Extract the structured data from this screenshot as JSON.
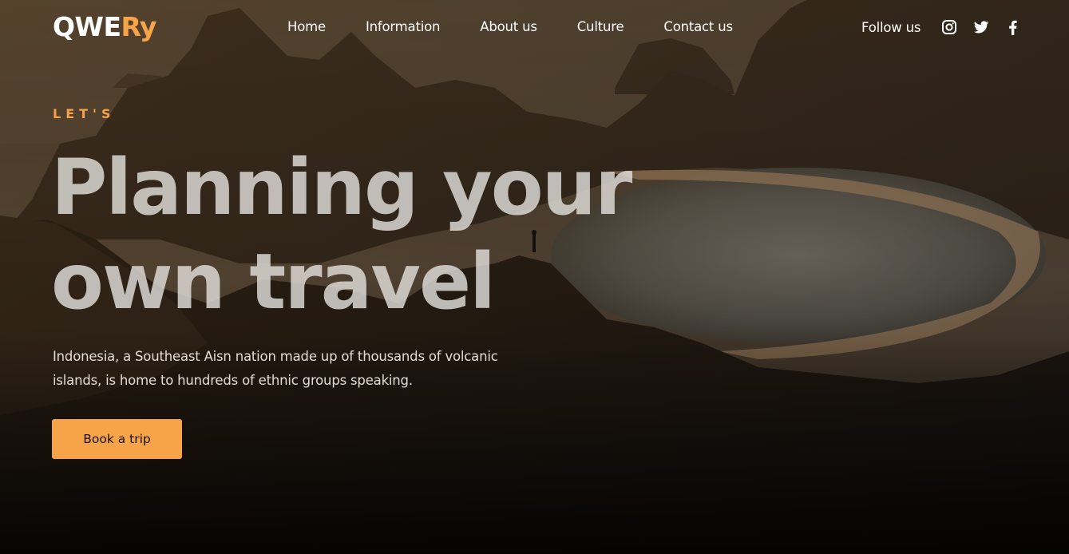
{
  "brand": {
    "part1": "QWE",
    "part2": "Ry",
    "accent_color": "#f7a449"
  },
  "nav": {
    "items": [
      {
        "label": "Home"
      },
      {
        "label": "Information"
      },
      {
        "label": "About us"
      },
      {
        "label": "Culture"
      },
      {
        "label": "Contact us"
      }
    ]
  },
  "social": {
    "label": "Follow us",
    "icons": [
      "instagram-icon",
      "twitter-icon",
      "facebook-icon"
    ]
  },
  "hero": {
    "eyebrow": "LET'S",
    "title_line1": "Planning your",
    "title_line2": "own travel",
    "description": "Indonesia, a Southeast Aisn nation made up of thousands of volcanic islands, is home to hundreds of ethnic groups speaking.",
    "cta_label": "Book a trip",
    "background": "mountain-bay-landscape-photo"
  }
}
